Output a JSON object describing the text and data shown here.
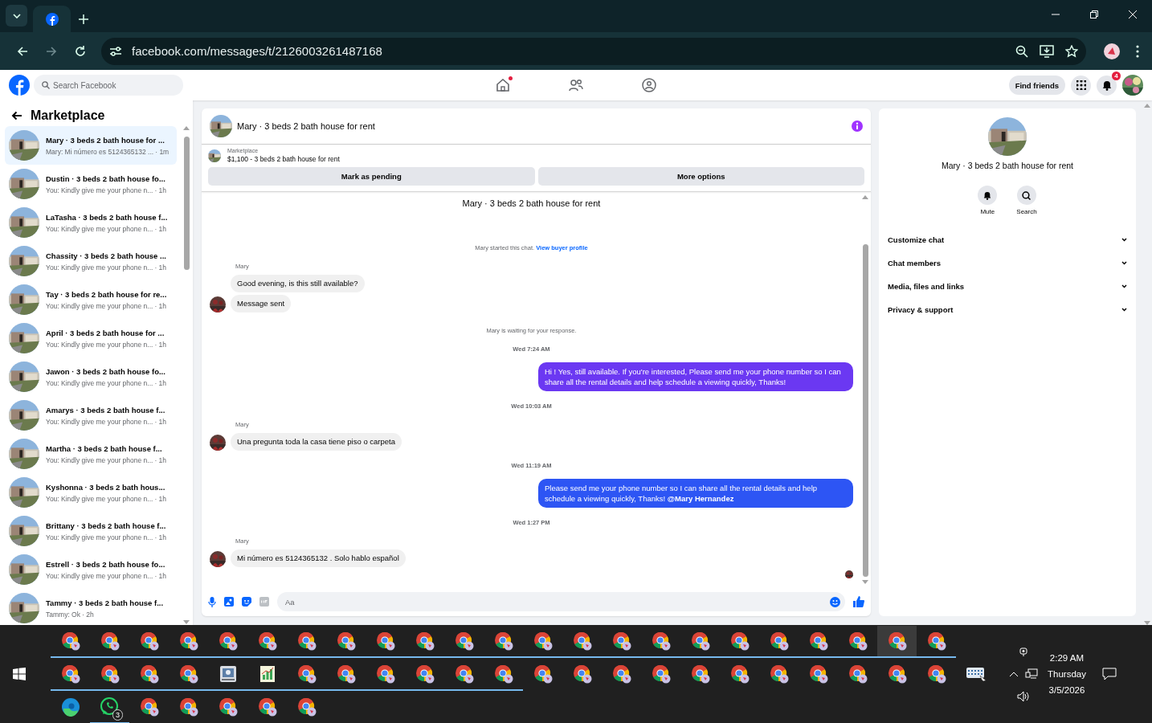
{
  "browser": {
    "tabs": [
      {
        "kind": "facebook",
        "selected": true
      }
    ],
    "url": "facebook.com/messages/t/2126003261487168"
  },
  "fb_header": {
    "search_placeholder": "Search Facebook",
    "nav": [
      {
        "kind": "home",
        "dot": true
      },
      {
        "kind": "friends",
        "dot": false
      },
      {
        "kind": "groups",
        "dot": false
      }
    ],
    "find_friends": "Find friends",
    "notification_count": "4"
  },
  "sidebar": {
    "title": "Marketplace",
    "conversations": [
      {
        "title": "Mary · 3 beds 2 bath house for ...",
        "preview": "Mary: Mi número es 5124365132 ...",
        "time": "· 1m",
        "selected": true
      },
      {
        "title": "Dustin · 3 beds 2 bath house fo...",
        "preview": "You: Kindly give me your phone n...",
        "time": "· 1h",
        "selected": false
      },
      {
        "title": "LaTasha · 3 beds 2 bath house f...",
        "preview": "You: Kindly give me your phone n...",
        "time": "· 1h",
        "selected": false
      },
      {
        "title": "Chassity · 3 beds 2 bath house ...",
        "preview": "You: Kindly give me your phone n...",
        "time": "· 1h",
        "selected": false
      },
      {
        "title": "Tay · 3 beds 2 bath house for re...",
        "preview": "You: Kindly give me your phone n...",
        "time": "· 1h",
        "selected": false
      },
      {
        "title": "April · 3 beds 2 bath house for ...",
        "preview": "You: Kindly give me your phone n...",
        "time": "· 1h",
        "selected": false
      },
      {
        "title": "Jawon · 3 beds 2 bath house fo...",
        "preview": "You: Kindly give me your phone n...",
        "time": "· 1h",
        "selected": false
      },
      {
        "title": "Amarys · 3 beds 2 bath house f...",
        "preview": "You: Kindly give me your phone n...",
        "time": "· 1h",
        "selected": false
      },
      {
        "title": "Martha · 3 beds 2 bath house f...",
        "preview": "You: Kindly give me your phone n...",
        "time": "· 1h",
        "selected": false
      },
      {
        "title": "Kyshonna · 3 beds 2 bath hous...",
        "preview": "You: Kindly give me your phone n...",
        "time": "· 1h",
        "selected": false
      },
      {
        "title": "Brittany · 3 beds 2 bath house f...",
        "preview": "You: Kindly give me your phone n...",
        "time": "· 1h",
        "selected": false
      },
      {
        "title": "Estrell · 3 beds 2 bath house fo...",
        "preview": "You: Kindly give me your phone n...",
        "time": "· 1h",
        "selected": false
      },
      {
        "title": "Tammy · 3 beds 2 bath house f...",
        "preview": "Tammy: Ok",
        "time": "· 2h",
        "selected": false
      }
    ]
  },
  "chat": {
    "title": "Mary · 3 beds 2 bath house for rent",
    "listing": {
      "label": "Marketplace",
      "title": "$1,100 - 3 beds 2 bath house for rent"
    },
    "actions": [
      "Mark as pending",
      "More options"
    ],
    "intro_title": "Mary · 3 beds 2 bath house for rent",
    "messages": [
      {
        "kind": "system",
        "text": "Mary started this chat.",
        "link": "View buyer profile"
      },
      {
        "kind": "name",
        "text": "Mary"
      },
      {
        "kind": "in",
        "text": "Good evening, is this still available?",
        "avatar": false
      },
      {
        "kind": "in",
        "text": "Message sent",
        "avatar": true
      },
      {
        "kind": "system",
        "text": "Mary is waiting for your response."
      },
      {
        "kind": "time",
        "text": "Wed 7:24 AM"
      },
      {
        "kind": "out",
        "text": "Hi ! Yes, still available. If you're interested, Please send me your phone number so I can share all the rental details and help schedule a viewing quickly, Thanks!",
        "color": "#6b38f2"
      },
      {
        "kind": "time",
        "text": "Wed 10:03 AM"
      },
      {
        "kind": "name",
        "text": "Mary"
      },
      {
        "kind": "in",
        "text": "Una pregunta toda la casa tiene piso o carpeta",
        "avatar": true
      },
      {
        "kind": "time",
        "text": "Wed 11:19 AM"
      },
      {
        "kind": "out",
        "text": "Please send me your phone number so I can share all the rental details and help schedule a viewing quickly, Thanks! **@Mary Hernandez**",
        "color": "#2d55f4"
      },
      {
        "kind": "time",
        "text": "Wed 1:27 PM"
      },
      {
        "kind": "name",
        "text": "Mary"
      },
      {
        "kind": "in",
        "text": "Mi número es 5124365132 . Solo hablo español",
        "avatar": true
      },
      {
        "kind": "seen"
      }
    ],
    "composer_placeholder": "Aa"
  },
  "info_panel": {
    "title": "Mary · 3 beds 2 bath house for rent",
    "actions": [
      {
        "kind": "mute",
        "label": "Mute"
      },
      {
        "kind": "search",
        "label": "Search"
      }
    ],
    "sections": [
      "Customize chat",
      "Chat members",
      "Media, files and links",
      "Privacy & support"
    ]
  },
  "taskbar": {
    "rows": [
      [
        {
          "kind": "chrome",
          "running": true,
          "selected": false
        },
        {
          "kind": "chrome",
          "running": true,
          "selected": false
        },
        {
          "kind": "chrome",
          "running": true,
          "selected": false
        },
        {
          "kind": "chrome",
          "running": true,
          "selected": false
        },
        {
          "kind": "chrome",
          "running": true,
          "selected": false
        },
        {
          "kind": "chrome",
          "running": true,
          "selected": false
        },
        {
          "kind": "chrome",
          "running": true,
          "selected": false
        },
        {
          "kind": "chrome",
          "running": true,
          "selected": false
        },
        {
          "kind": "chrome",
          "running": true,
          "selected": false
        },
        {
          "kind": "chrome",
          "running": true,
          "selected": false
        },
        {
          "kind": "chrome",
          "running": true,
          "selected": false
        },
        {
          "kind": "chrome",
          "running": true,
          "selected": false
        },
        {
          "kind": "chrome",
          "running": true,
          "selected": false
        },
        {
          "kind": "chrome",
          "running": true,
          "selected": false
        },
        {
          "kind": "chrome",
          "running": true,
          "selected": false
        },
        {
          "kind": "chrome",
          "running": true,
          "selected": false
        },
        {
          "kind": "chrome",
          "running": true,
          "selected": false
        },
        {
          "kind": "chrome",
          "running": true,
          "selected": false
        },
        {
          "kind": "chrome",
          "running": true,
          "selected": false
        },
        {
          "kind": "chrome",
          "running": true,
          "selected": false
        },
        {
          "kind": "chrome",
          "running": true,
          "selected": false
        },
        {
          "kind": "chrome",
          "running": true,
          "selected": true
        },
        {
          "kind": "chrome",
          "running": true,
          "selected": false
        }
      ],
      [
        {
          "kind": "chrome",
          "running": true,
          "selected": false
        },
        {
          "kind": "chrome",
          "running": true,
          "selected": false
        },
        {
          "kind": "chrome",
          "running": true,
          "selected": false
        },
        {
          "kind": "chrome",
          "running": true,
          "selected": false
        },
        {
          "kind": "drive",
          "running": true,
          "selected": false
        },
        {
          "kind": "chart",
          "running": true,
          "selected": false
        },
        {
          "kind": "chrome",
          "running": true,
          "selected": false
        },
        {
          "kind": "chrome",
          "running": true,
          "selected": false
        },
        {
          "kind": "chrome",
          "running": true,
          "selected": false
        },
        {
          "kind": "chrome",
          "running": true,
          "selected": false
        },
        {
          "kind": "chrome",
          "running": true,
          "selected": false
        },
        {
          "kind": "chrome",
          "running": true,
          "selected": false
        },
        {
          "kind": "chrome",
          "running": false,
          "selected": false
        },
        {
          "kind": "chrome",
          "running": false,
          "selected": false
        },
        {
          "kind": "chrome",
          "running": false,
          "selected": false
        },
        {
          "kind": "chrome",
          "running": false,
          "selected": false
        },
        {
          "kind": "chrome",
          "running": false,
          "selected": false
        },
        {
          "kind": "chrome",
          "running": false,
          "selected": false
        },
        {
          "kind": "chrome",
          "running": false,
          "selected": false
        },
        {
          "kind": "chrome",
          "running": false,
          "selected": false
        },
        {
          "kind": "chrome",
          "running": false,
          "selected": false
        },
        {
          "kind": "chrome",
          "running": false,
          "selected": false
        },
        {
          "kind": "chrome",
          "running": false,
          "selected": false
        },
        {
          "kind": "keyboard",
          "running": false,
          "selected": false
        }
      ],
      [
        {
          "kind": "edge",
          "running": false,
          "selected": false
        },
        {
          "kind": "whatsapp",
          "running": true,
          "selected": false,
          "badge": "3"
        },
        {
          "kind": "chrome",
          "running": false,
          "selected": false
        },
        {
          "kind": "chrome",
          "running": false,
          "selected": false
        },
        {
          "kind": "chrome",
          "running": false,
          "selected": false
        },
        {
          "kind": "chrome",
          "running": false,
          "selected": false
        },
        {
          "kind": "chrome",
          "running": false,
          "selected": false
        }
      ]
    ],
    "clock": {
      "time": "2:29 AM",
      "day": "Thursday",
      "date": "3/5/2026"
    }
  }
}
